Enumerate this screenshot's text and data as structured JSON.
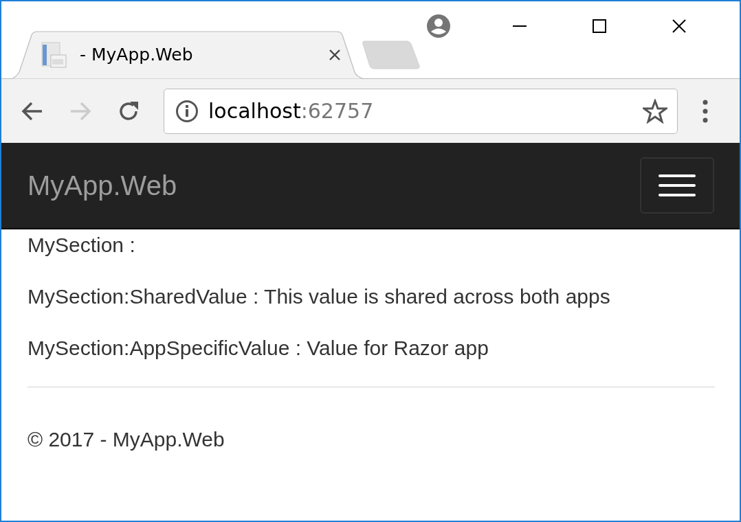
{
  "browser": {
    "tab": {
      "title": "- MyApp.Web"
    },
    "address": {
      "host": "localhost",
      "port": ":62757"
    }
  },
  "navbar": {
    "brand": "MyApp.Web"
  },
  "content": {
    "lines": [
      "MySection :",
      "MySection:SharedValue : This value is shared across both apps",
      "MySection:AppSpecificValue : Value for Razor app"
    ]
  },
  "footer": {
    "text": "© 2017 - MyApp.Web"
  }
}
